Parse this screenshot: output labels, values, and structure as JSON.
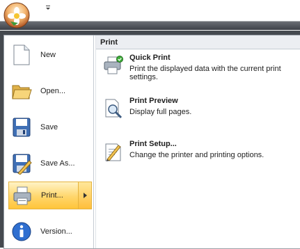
{
  "menu": {
    "items": [
      {
        "label": "New",
        "icon": "document-icon"
      },
      {
        "label": "Open...",
        "icon": "folder-open-icon"
      },
      {
        "label": "Save",
        "icon": "floppy-disk-icon"
      },
      {
        "label": "Save As...",
        "icon": "save-as-icon"
      },
      {
        "label": "Print...",
        "icon": "printer-icon",
        "selected": true
      },
      {
        "label": "Version...",
        "icon": "info-icon"
      }
    ]
  },
  "submenu": {
    "header": "Print",
    "items": [
      {
        "title": "Quick Print",
        "description": "Print the displayed data with the current print settings.",
        "icon": "quick-print-icon"
      },
      {
        "title": "Print Preview",
        "description": "Display full pages.",
        "icon": "print-preview-icon"
      },
      {
        "title": "Print Setup...",
        "description": "Change the printer and printing options.",
        "icon": "print-setup-icon"
      }
    ]
  },
  "colors": {
    "selected_start": "#fff3c6",
    "selected_end": "#ffc53a",
    "frame": "#45494f"
  }
}
